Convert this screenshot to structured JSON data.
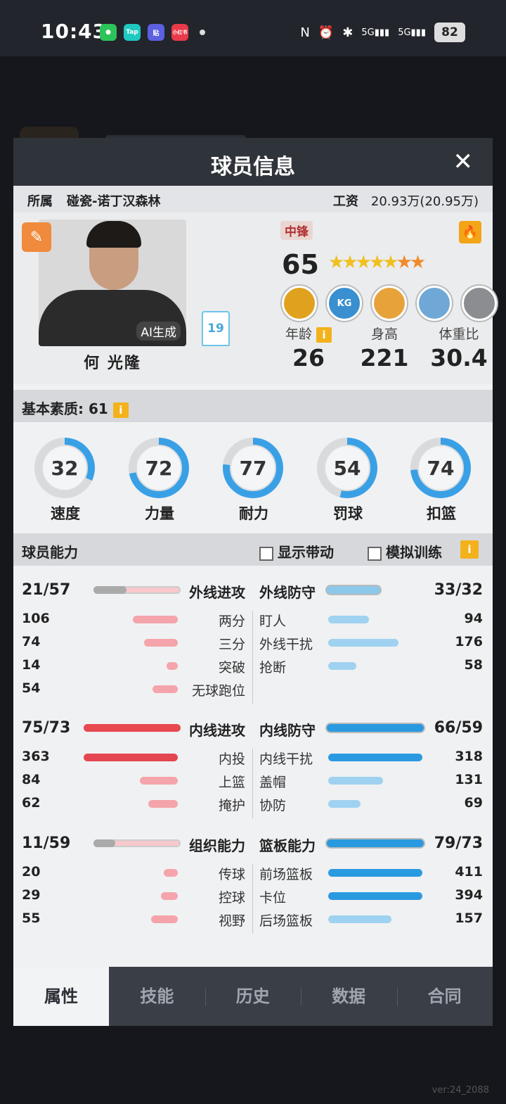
{
  "status_bar": {
    "time": "10:43",
    "apps": [
      "微信",
      "Tap",
      "贴",
      "小红书"
    ],
    "battery": "82",
    "signal_label": "5G"
  },
  "modal": {
    "title": "球员信息",
    "close": "✕"
  },
  "info_bar": {
    "team_label": "所属",
    "team": "碰瓷-诺丁汉森林",
    "salary_label": "工资",
    "salary": "20.93万(20.95万)"
  },
  "player": {
    "name": "何 光隆",
    "ai_tag": "AI生成",
    "jersey": "19",
    "position": "中锋",
    "overall": "65",
    "stars_gold": 5,
    "stars_orange": 2,
    "age_label": "年龄",
    "age": "26",
    "height_label": "身高",
    "height": "221",
    "bmi_label": "体重比",
    "bmi": "30.4",
    "badges": [
      {
        "icon": "medal-icon",
        "color": "#e0a21e"
      },
      {
        "icon": "kg-icon",
        "text": "KG",
        "color": "#3a8fd0"
      },
      {
        "icon": "lightning-icon",
        "color": "#e8a23a"
      },
      {
        "icon": "block-icon",
        "color": "#6fa8d6"
      },
      {
        "icon": "locked-hex-icon",
        "color": "#8b8d91"
      }
    ]
  },
  "basic": {
    "label": "基本素质: 61",
    "info": "i"
  },
  "basic_stats": [
    {
      "label": "速度",
      "value": "32",
      "pct": 32
    },
    {
      "label": "力量",
      "value": "72",
      "pct": 72
    },
    {
      "label": "耐力",
      "value": "77",
      "pct": 77
    },
    {
      "label": "罚球",
      "value": "54",
      "pct": 54
    },
    {
      "label": "扣篮",
      "value": "74",
      "pct": 74
    }
  ],
  "ability": {
    "label": "球员能力",
    "opt1": "显示带动",
    "opt2": "模拟训练",
    "info": "i"
  },
  "groups": [
    {
      "left": {
        "name": "外线进攻",
        "value": "21/57",
        "fill": 0.38,
        "color": "#aaa",
        "items": [
          {
            "n": "两分",
            "v": "106",
            "w": 64
          },
          {
            "n": "三分",
            "v": "74",
            "w": 48
          },
          {
            "n": "突破",
            "v": "14",
            "w": 16
          },
          {
            "n": "无球跑位",
            "v": "54",
            "w": 36
          }
        ]
      },
      "right": {
        "name": "外线防守",
        "value": "33/32",
        "fill": 0.55,
        "color": "#8cc8ea",
        "items": [
          {
            "n": "盯人",
            "v": "94",
            "w": 58
          },
          {
            "n": "外线干扰",
            "v": "176",
            "w": 100
          },
          {
            "n": "抢断",
            "v": "58",
            "w": 40
          }
        ]
      }
    },
    {
      "left": {
        "name": "内线进攻",
        "value": "75/73",
        "fill": 1.0,
        "color": "#e84850",
        "items": [
          {
            "n": "内投",
            "v": "363",
            "w": 134
          },
          {
            "n": "上篮",
            "v": "84",
            "w": 54
          },
          {
            "n": "掩护",
            "v": "62",
            "w": 42
          }
        ]
      },
      "right": {
        "name": "内线防守",
        "value": "66/59",
        "fill": 1.0,
        "color": "#2a9ae0",
        "items": [
          {
            "n": "内线干扰",
            "v": "318",
            "w": 134
          },
          {
            "n": "盖帽",
            "v": "131",
            "w": 78
          },
          {
            "n": "协防",
            "v": "69",
            "w": 46
          }
        ]
      }
    },
    {
      "left": {
        "name": "组织能力",
        "value": "11/59",
        "fill": 0.25,
        "color": "#aaa",
        "items": [
          {
            "n": "传球",
            "v": "20",
            "w": 20
          },
          {
            "n": "控球",
            "v": "29",
            "w": 24
          },
          {
            "n": "视野",
            "v": "55",
            "w": 38
          }
        ]
      },
      "right": {
        "name": "篮板能力",
        "value": "79/73",
        "fill": 1.0,
        "color": "#2a9ae0",
        "items": [
          {
            "n": "前场篮板",
            "v": "411",
            "w": 134
          },
          {
            "n": "卡位",
            "v": "394",
            "w": 134
          },
          {
            "n": "后场篮板",
            "v": "157",
            "w": 90
          }
        ]
      }
    }
  ],
  "tabs": [
    {
      "label": "属性",
      "active": true
    },
    {
      "label": "技能"
    },
    {
      "label": "历史"
    },
    {
      "label": "数据"
    },
    {
      "label": "合同"
    }
  ],
  "version": "ver:24_2088"
}
